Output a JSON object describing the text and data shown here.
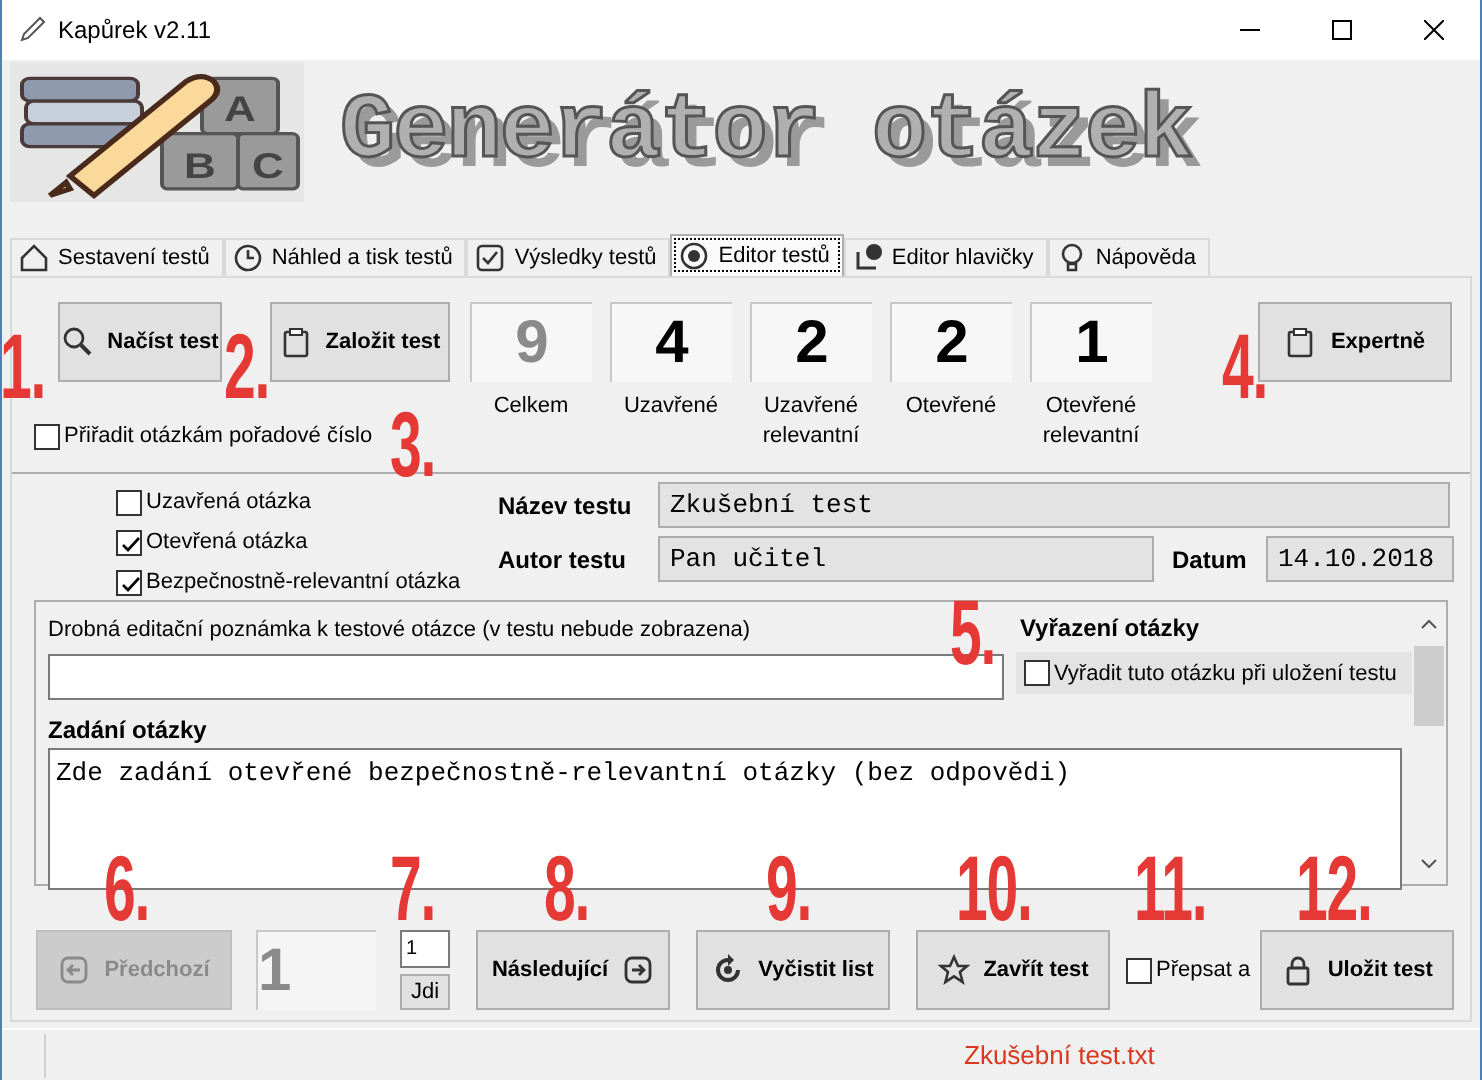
{
  "window": {
    "title": "Kapůrek v2.11"
  },
  "banner": {
    "logo_letters": [
      "A",
      "B",
      "C"
    ],
    "title": "Generátor otázek"
  },
  "tabs": [
    {
      "label": "Sestavení testů",
      "selected": false
    },
    {
      "label": "Náhled a tisk testů",
      "selected": false
    },
    {
      "label": "Výsledky testů",
      "selected": false
    },
    {
      "label": "Editor testů",
      "selected": true
    },
    {
      "label": "Editor hlavičky",
      "selected": false
    },
    {
      "label": "Nápověda",
      "selected": false
    }
  ],
  "top_buttons": [
    {
      "label": "Načíst test"
    },
    {
      "label": "Založit test"
    }
  ],
  "order_checkbox": {
    "label": "Přiřadit otázkám pořadové číslo",
    "checked": false
  },
  "counters": [
    {
      "value": "9",
      "label": "Celkem",
      "muted": true
    },
    {
      "value": "4",
      "label": "Uzavřené",
      "muted": false
    },
    {
      "value": "2",
      "label": "Uzavřené relevantní",
      "muted": false
    },
    {
      "value": "2",
      "label": "Otevřené",
      "muted": false
    },
    {
      "value": "1",
      "label": "Otevřené relevantní",
      "muted": false
    }
  ],
  "expert_button": {
    "label": "Expertně"
  },
  "question_types": [
    {
      "label": "Uzavřená otázka",
      "checked": false
    },
    {
      "label": "Otevřená otázka",
      "checked": true
    },
    {
      "label": "Bezpečnostně-relevantní otázka",
      "checked": true
    }
  ],
  "test_name": {
    "label": "Název testu",
    "value": "Zkušební test"
  },
  "author": {
    "label": "Autor testu",
    "value": "Pan učitel"
  },
  "date": {
    "label": "Datum",
    "value": "14.10.2018"
  },
  "note": {
    "label": "Drobná editační poznámka k testové otázce (v testu nebude zobrazena)"
  },
  "exclusion": {
    "title": "Vyřazení otázky",
    "label": "Vyřadit tuto otázku při uložení testu",
    "checked": false
  },
  "question": {
    "label": "Zadání otázky",
    "value": "Zde zadání otevřené bezpečnostně-relevantní otázky (bez odpovědi)"
  },
  "navigation": {
    "previous": {
      "label": "Předchozí",
      "disabled": true
    },
    "page": "1",
    "jump_value": "1",
    "jump_button": "Jdi",
    "next": "Následující"
  },
  "clear_button": "Vyčistit list",
  "close_button": "Zavřít test",
  "overwrite": {
    "label": "Přepsat a",
    "checked": false
  },
  "save_button": "Uložit test",
  "status_bar": {
    "file": "Zkušební test.txt"
  },
  "annotations": [
    "1.",
    "2.",
    "3.",
    "4.",
    "5.",
    "6.",
    "7.",
    "8.",
    "9.",
    "10.",
    "11.",
    "12."
  ]
}
